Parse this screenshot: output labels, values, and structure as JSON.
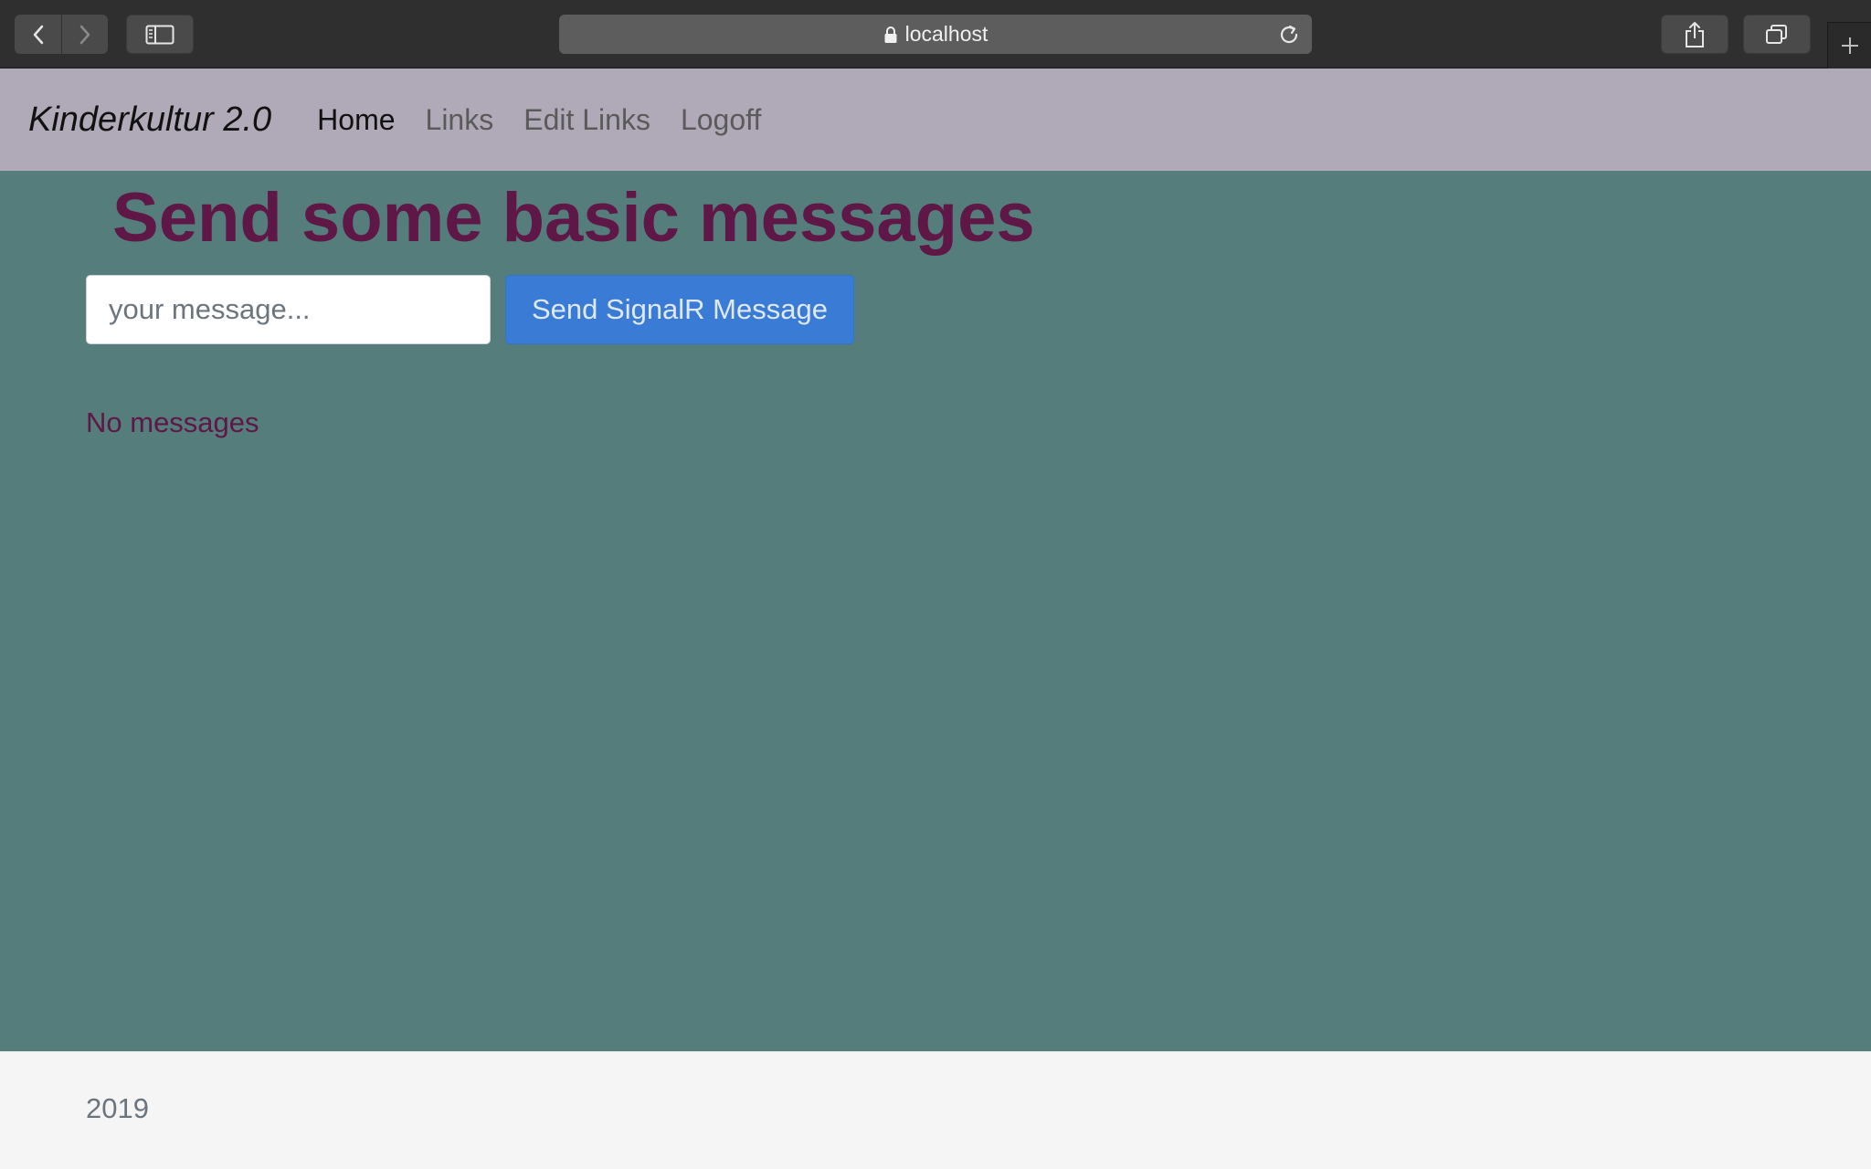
{
  "browser": {
    "url": "localhost",
    "icons": [
      "back-icon",
      "forward-icon",
      "sidebar-icon",
      "lock-icon",
      "reload-icon",
      "share-icon",
      "tabs-icon",
      "plus-icon"
    ]
  },
  "navbar": {
    "brand": "Kinderkultur 2.0",
    "links": [
      {
        "label": "Home",
        "active": true
      },
      {
        "label": "Links",
        "active": false
      },
      {
        "label": "Edit Links",
        "active": false
      },
      {
        "label": "Logoff",
        "active": false
      }
    ],
    "background": "#b0aab8"
  },
  "main": {
    "title": "Send some basic messages",
    "input_placeholder": "your message...",
    "input_value": "",
    "send_label": "Send SignalR Message",
    "status": "No messages",
    "background": "#557d7b",
    "accent": "#5e1747",
    "button_color": "#3a7bd5"
  },
  "footer": {
    "text": "2019"
  }
}
